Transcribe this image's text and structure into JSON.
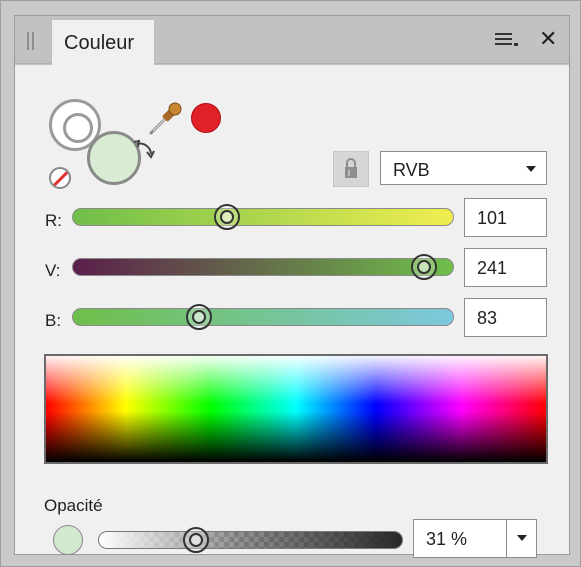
{
  "panel": {
    "tab_label": "Couleur"
  },
  "color": {
    "fill": "#d7ecd2",
    "current": "#e02128",
    "model": "RVB"
  },
  "sliders": [
    {
      "label": "R:",
      "value": "101",
      "level": 0.4,
      "gradient": [
        "#6fbf4a",
        "#f0ee50"
      ]
    },
    {
      "label": "V:",
      "value": "241",
      "level": 0.95,
      "gradient": [
        "#5b1e4b",
        "#6fbf4a"
      ]
    },
    {
      "label": "B:",
      "value": "83",
      "level": 0.33,
      "gradient": [
        "#6fbf4a",
        "#7cc8de"
      ]
    }
  ],
  "opacity": {
    "label": "Opacité",
    "value": "31 %",
    "level": 0.31
  },
  "icons": {
    "menu": "panel-menu-icon",
    "close": "close-icon",
    "swap": "swap-colors-icon",
    "eyedropper": "eyedropper-icon",
    "lock": "lock-icon",
    "none": "no-color-icon"
  }
}
